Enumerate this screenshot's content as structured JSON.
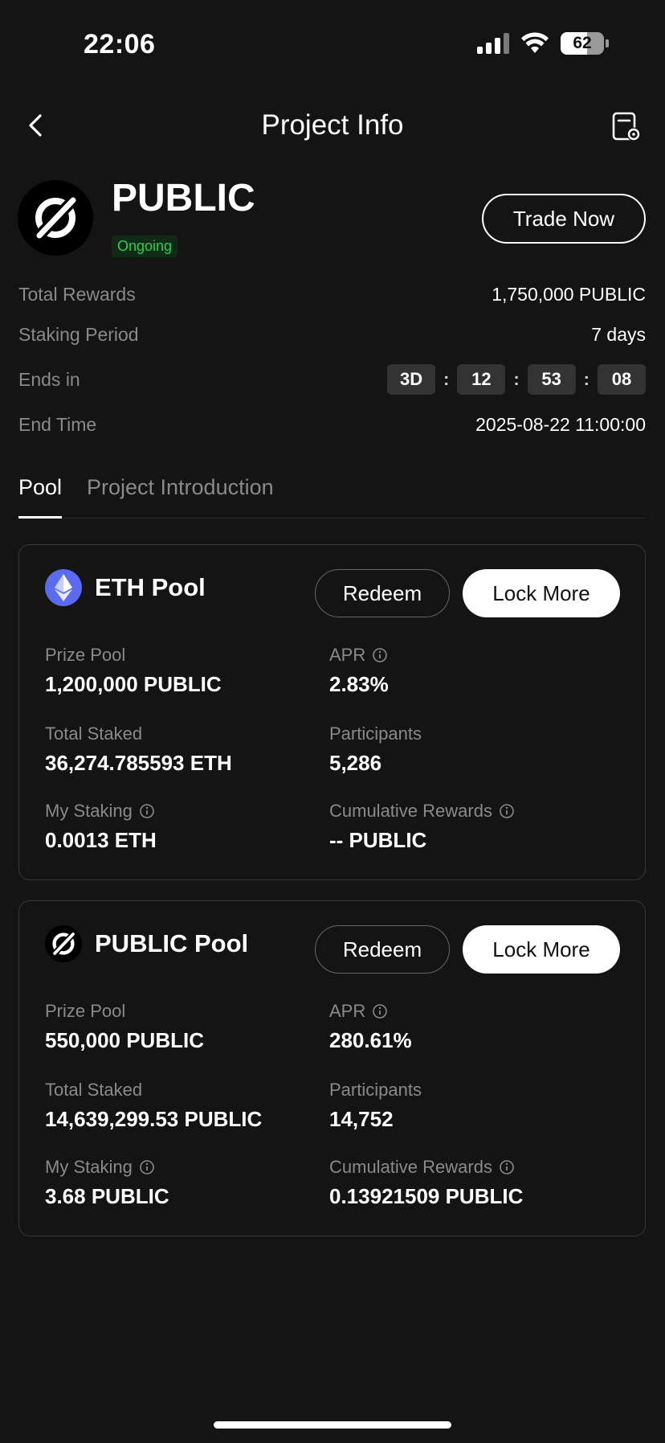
{
  "status_bar": {
    "time": "22:06",
    "battery": "62",
    "battery_percent": 62
  },
  "nav": {
    "title": "Project Info"
  },
  "project": {
    "name": "PUBLIC",
    "status": "Ongoing",
    "trade_label": "Trade Now"
  },
  "info": {
    "total_rewards_label": "Total Rewards",
    "total_rewards_value": "1,750,000 PUBLIC",
    "staking_period_label": "Staking Period",
    "staking_period_value": "7 days",
    "ends_in_label": "Ends in",
    "countdown": {
      "days": "3D",
      "hours": "12",
      "minutes": "53",
      "seconds": "08"
    },
    "end_time_label": "End Time",
    "end_time_value": "2025-08-22 11:00:00"
  },
  "tabs": [
    {
      "label": "Pool",
      "active": true
    },
    {
      "label": "Project Introduction",
      "active": false
    }
  ],
  "pools": [
    {
      "name": "ETH Pool",
      "redeem_label": "Redeem",
      "lock_label": "Lock More",
      "prize_pool_label": "Prize Pool",
      "prize_pool_value": "1,200,000 PUBLIC",
      "apr_label": "APR",
      "apr_value": "2.83%",
      "total_staked_label": "Total Staked",
      "total_staked_value": "36,274.785593 ETH",
      "participants_label": "Participants",
      "participants_value": "5,286",
      "my_staking_label": "My Staking",
      "my_staking_value": "0.0013 ETH",
      "cumulative_label": "Cumulative Rewards",
      "cumulative_value": "-- PUBLIC"
    },
    {
      "name": "PUBLIC Pool",
      "redeem_label": "Redeem",
      "lock_label": "Lock More",
      "prize_pool_label": "Prize Pool",
      "prize_pool_value": "550,000 PUBLIC",
      "apr_label": "APR",
      "apr_value": "280.61%",
      "total_staked_label": "Total Staked",
      "total_staked_value": "14,639,299.53 PUBLIC",
      "participants_label": "Participants",
      "participants_value": "14,752",
      "my_staking_label": "My Staking",
      "my_staking_value": "3.68 PUBLIC",
      "cumulative_label": "Cumulative Rewards",
      "cumulative_value": "0.13921509 PUBLIC"
    }
  ],
  "colors": {
    "background": "#141414",
    "ongoing": "#2ecc52",
    "eth": "#5b6bf0"
  }
}
